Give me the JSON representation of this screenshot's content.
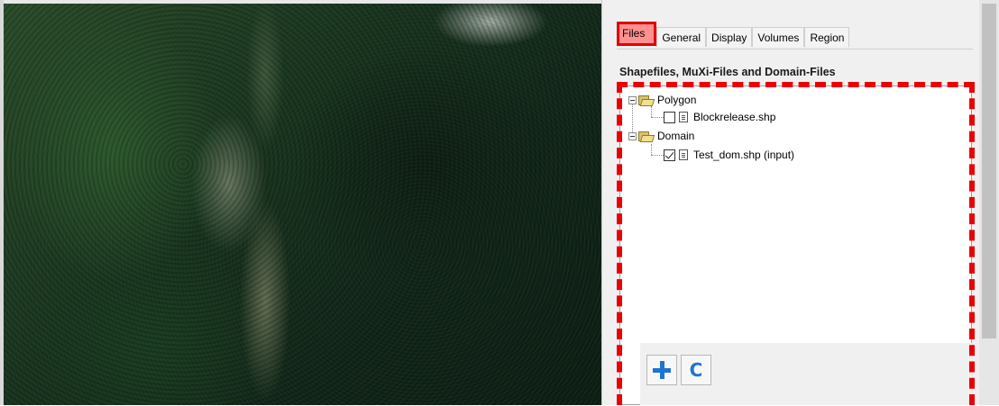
{
  "panel": {
    "tabs": [
      {
        "label": "Files",
        "active": true
      },
      {
        "label": "General",
        "active": false
      },
      {
        "label": "Display",
        "active": false
      },
      {
        "label": "Volumes",
        "active": false
      },
      {
        "label": "Region",
        "active": false
      }
    ],
    "section_title": "Shapefiles, MuXi-Files and Domain-Files",
    "tree": [
      {
        "label": "Polygon",
        "type": "folder",
        "expanded": true,
        "children": [
          {
            "label": "Blockrelease.shp",
            "checked": false
          }
        ]
      },
      {
        "label": "Domain",
        "type": "folder",
        "expanded": true,
        "children": [
          {
            "label": "Test_dom.shp (input)",
            "checked": true
          }
        ]
      }
    ],
    "toolbar": {
      "add_icon": "plus-icon",
      "refresh_icon": "refresh-icon",
      "refresh_glyph": "C"
    }
  },
  "colors": {
    "highlight_red": "#e00000",
    "accent_blue": "#1f73d0"
  }
}
